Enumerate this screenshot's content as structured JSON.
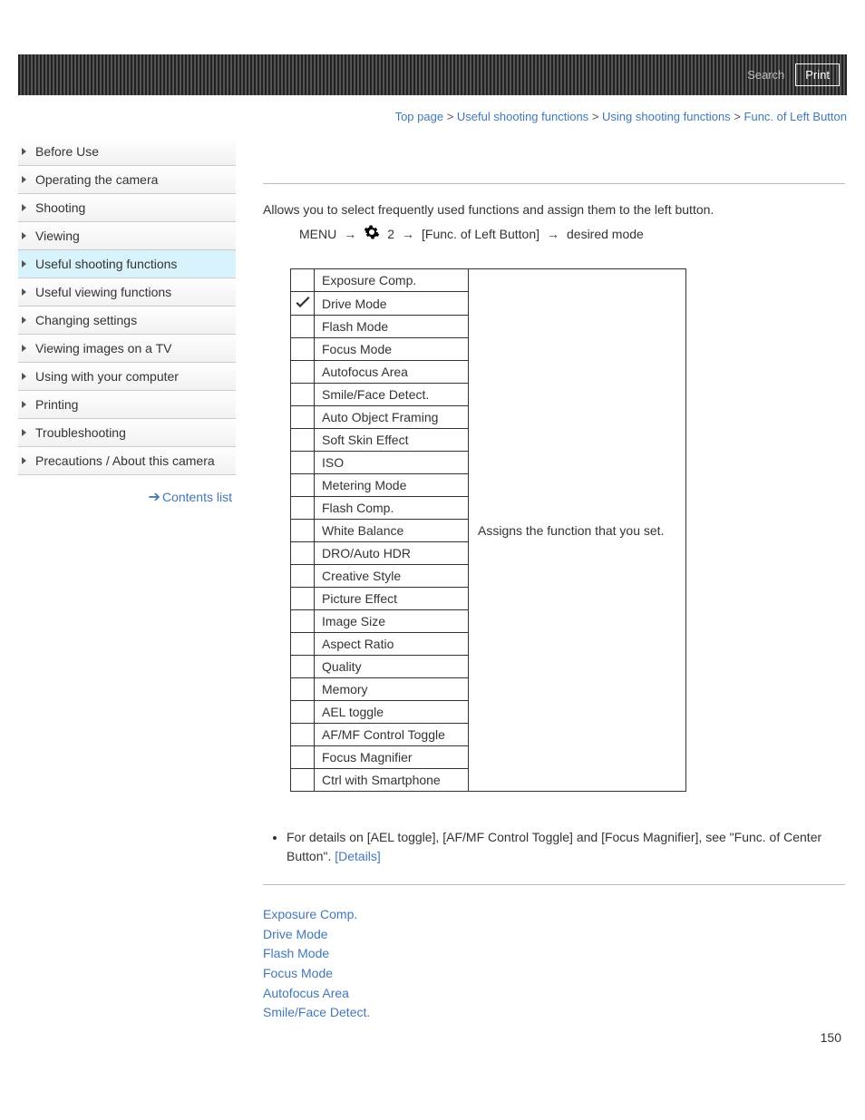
{
  "header": {
    "search": "Search",
    "print": "Print"
  },
  "breadcrumb": {
    "top": "Top page",
    "sec": "Useful shooting functions",
    "sub": "Using shooting functions",
    "cur": "Func. of Left Button",
    "sep": " > "
  },
  "sidebar": {
    "items": [
      "Before Use",
      "Operating the camera",
      "Shooting",
      "Viewing",
      "Useful shooting functions",
      "Useful viewing functions",
      "Changing settings",
      "Viewing images on a TV",
      "Using with your computer",
      "Printing",
      "Troubleshooting",
      "Precautions / About this camera"
    ],
    "active_index": 4,
    "contents_list": "Contents list"
  },
  "intro": "Allows you to select frequently used functions and assign them to the left button.",
  "menu_path": {
    "menu": "MENU",
    "num": "2",
    "step1": "[Func. of Left Button]",
    "step2": "desired mode"
  },
  "table": {
    "desc": "Assigns the function that you set.",
    "checked_index": 1,
    "rows": [
      "Exposure Comp.",
      "Drive Mode",
      "Flash Mode",
      "Focus Mode",
      "Autofocus Area",
      "Smile/Face Detect.",
      "Auto Object Framing",
      "Soft Skin Effect",
      "ISO",
      "Metering Mode",
      "Flash Comp.",
      "White Balance",
      "DRO/Auto HDR",
      "Creative Style",
      "Picture Effect",
      "Image Size",
      "Aspect Ratio",
      "Quality",
      "Memory",
      "AEL toggle",
      "AF/MF Control Toggle",
      "Focus Magnifier",
      "Ctrl with Smartphone"
    ]
  },
  "notes": {
    "text_a": "For details on [AEL toggle], [AF/MF Control Toggle] and [Focus Magnifier], see \"Func. of Center Button\". ",
    "details": "[Details]"
  },
  "related": [
    "Exposure Comp.",
    "Drive Mode",
    "Flash Mode",
    "Focus Mode",
    "Autofocus Area",
    "Smile/Face Detect."
  ],
  "page_number": "150"
}
